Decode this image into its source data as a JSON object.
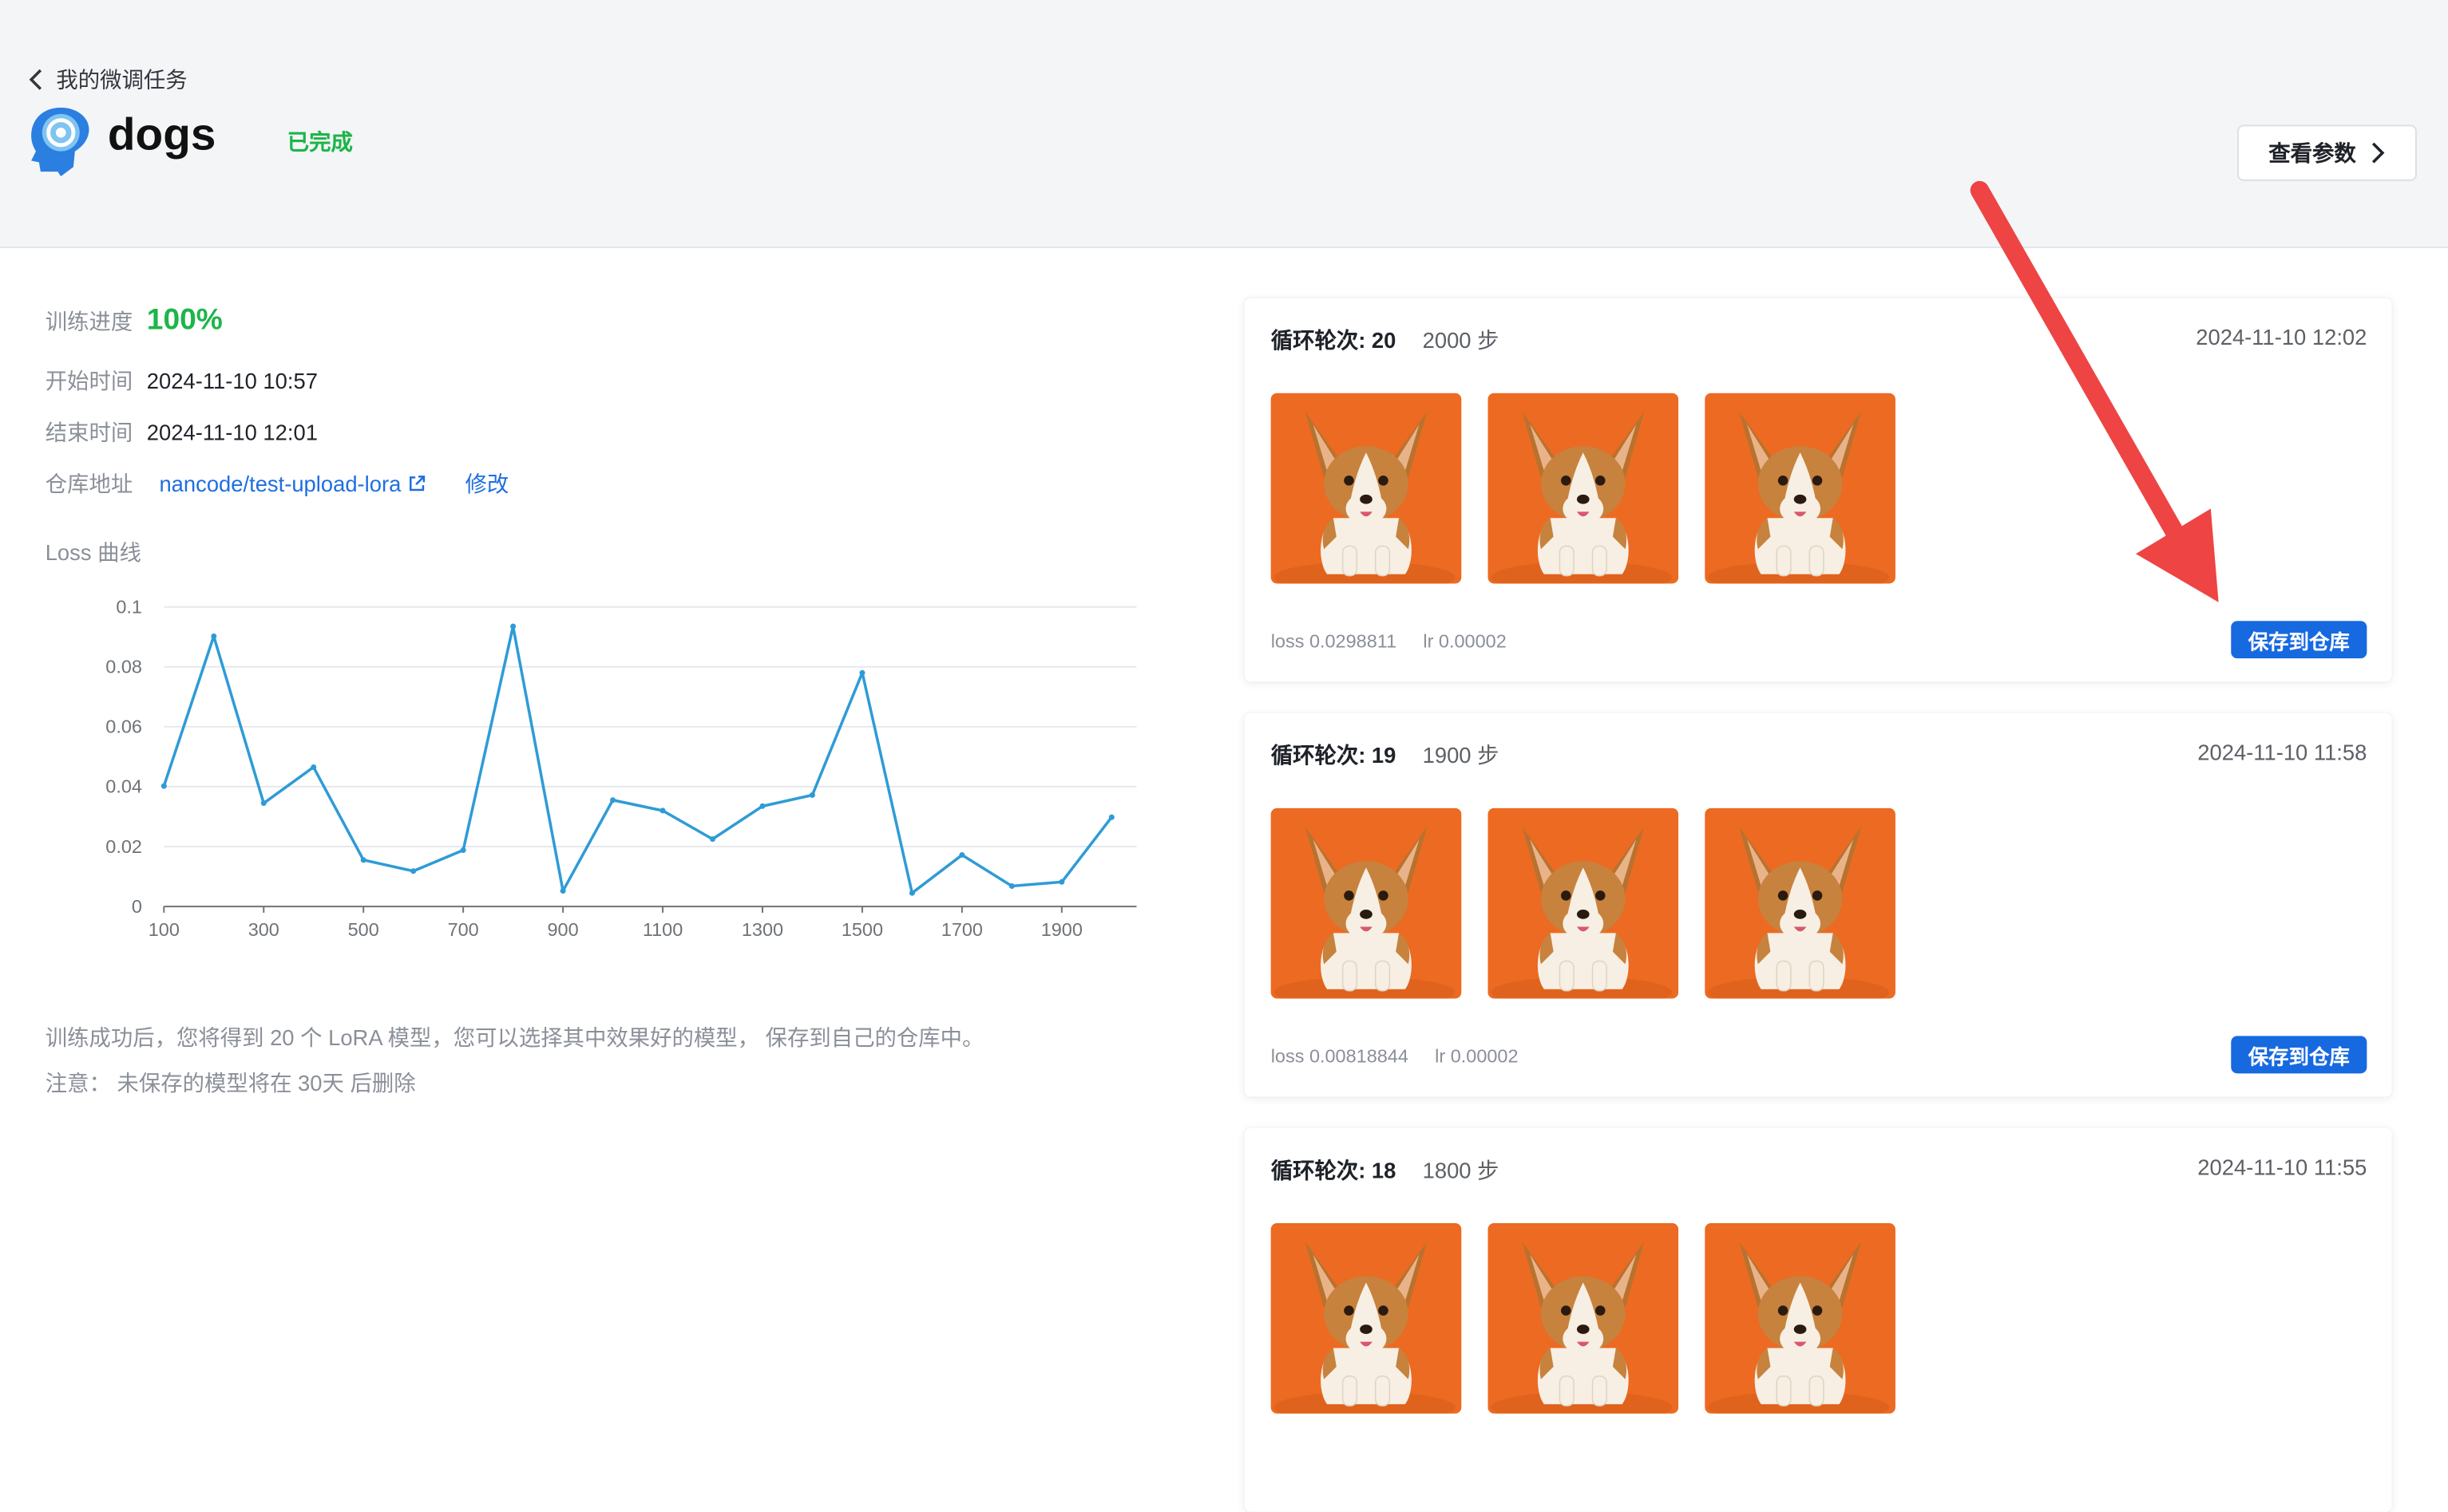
{
  "header": {
    "back_label": "我的微调任务",
    "title": "dogs",
    "status": "已完成",
    "view_params_label": "查看参数"
  },
  "info": {
    "progress_label": "训练进度",
    "progress_value": "100%",
    "start_label": "开始时间",
    "start_value": "2024-11-10 10:57",
    "end_label": "结束时间",
    "end_value": "2024-11-10 12:01",
    "repo_label": "仓库地址",
    "repo_value": "nancode/test-upload-lora",
    "edit_label": "修改"
  },
  "loss_chart_title": "Loss 曲线",
  "chart_data": {
    "type": "line",
    "x": [
      100,
      200,
      300,
      400,
      500,
      600,
      700,
      800,
      900,
      1000,
      1100,
      1200,
      1300,
      1400,
      1500,
      1600,
      1700,
      1800,
      1900,
      2000
    ],
    "values": [
      0.0402,
      0.0902,
      0.0345,
      0.0465,
      0.0155,
      0.0118,
      0.0188,
      0.0935,
      0.0052,
      0.0355,
      0.032,
      0.0225,
      0.0335,
      0.0372,
      0.078,
      0.0045,
      0.0172,
      0.0068,
      0.0082,
      0.0298
    ],
    "xticks": [
      "100",
      "300",
      "500",
      "700",
      "900",
      "1100",
      "1300",
      "1500",
      "1700",
      "1900"
    ],
    "yticks": [
      "0",
      "0.02",
      "0.04",
      "0.06",
      "0.08",
      "0.1"
    ],
    "ylim": [
      0,
      0.1
    ],
    "line_color": "#2f9bd6"
  },
  "notes": {
    "line1": "训练成功后，您将得到 20 个 LoRA 模型，您可以选择其中效果好的模型， 保存到自己的仓库中。",
    "line2": "注意：  未保存的模型将在 30天 后删除"
  },
  "checkpoints": [
    {
      "epoch": "循环轮次: 20",
      "steps": "2000 步",
      "time": "2024-11-10 12:02",
      "loss": "loss 0.0298811",
      "lr": "lr 0.00002",
      "save_label": "保存到仓库"
    },
    {
      "epoch": "循环轮次: 19",
      "steps": "1900 步",
      "time": "2024-11-10 11:58",
      "loss": "loss 0.00818844",
      "lr": "lr 0.00002",
      "save_label": "保存到仓库"
    },
    {
      "epoch": "循环轮次: 18",
      "steps": "1800 步",
      "time": "2024-11-10 11:55"
    }
  ],
  "colors": {
    "accent": "#1769e0",
    "success": "#1db54a",
    "annotation_arrow": "#ee4444"
  }
}
